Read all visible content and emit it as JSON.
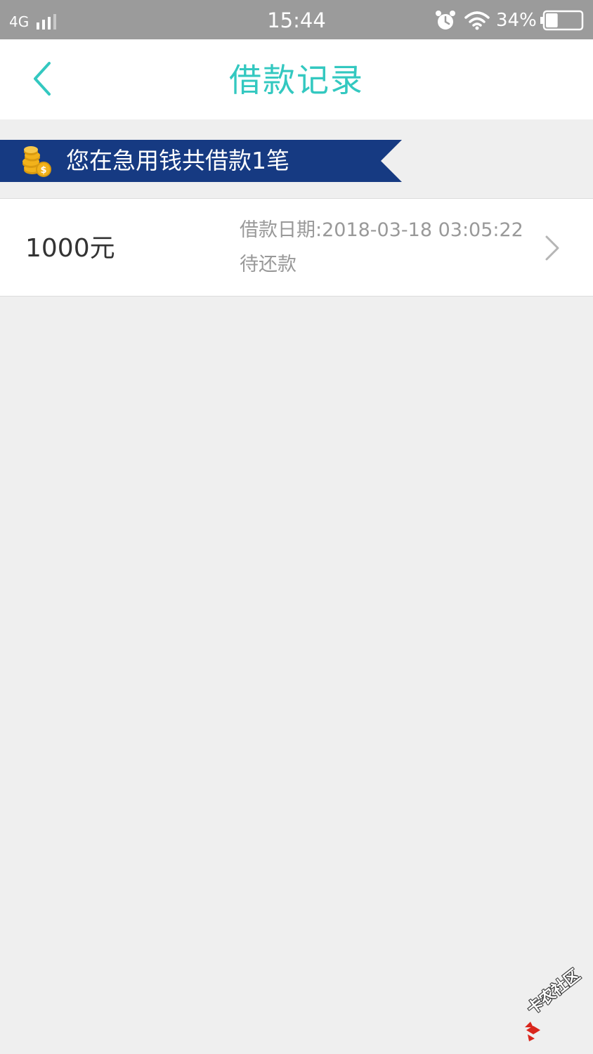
{
  "status_bar": {
    "network": "4G",
    "time": "15:44",
    "battery_percent": "34%",
    "battery_level": 0.34,
    "icons": [
      "signal-icon",
      "alarm-icon",
      "wifi-icon",
      "battery-icon"
    ]
  },
  "nav": {
    "title": "借款记录",
    "back_icon": "chevron-left-icon"
  },
  "banner": {
    "text": "您在急用钱共借款1笔",
    "icon": "coins-icon"
  },
  "loans": [
    {
      "amount": "1000元",
      "date_line": "借款日期:2018-03-18 03:05:22",
      "status": "待还款"
    }
  ],
  "watermark": {
    "text": "卡农社区"
  },
  "colors": {
    "accent": "#33c8c0",
    "banner": "#163a82",
    "page_bg": "#efefef",
    "status_bar_bg": "#9b9b9b",
    "secondary_text": "#999999",
    "coin": "#f2b21b"
  }
}
